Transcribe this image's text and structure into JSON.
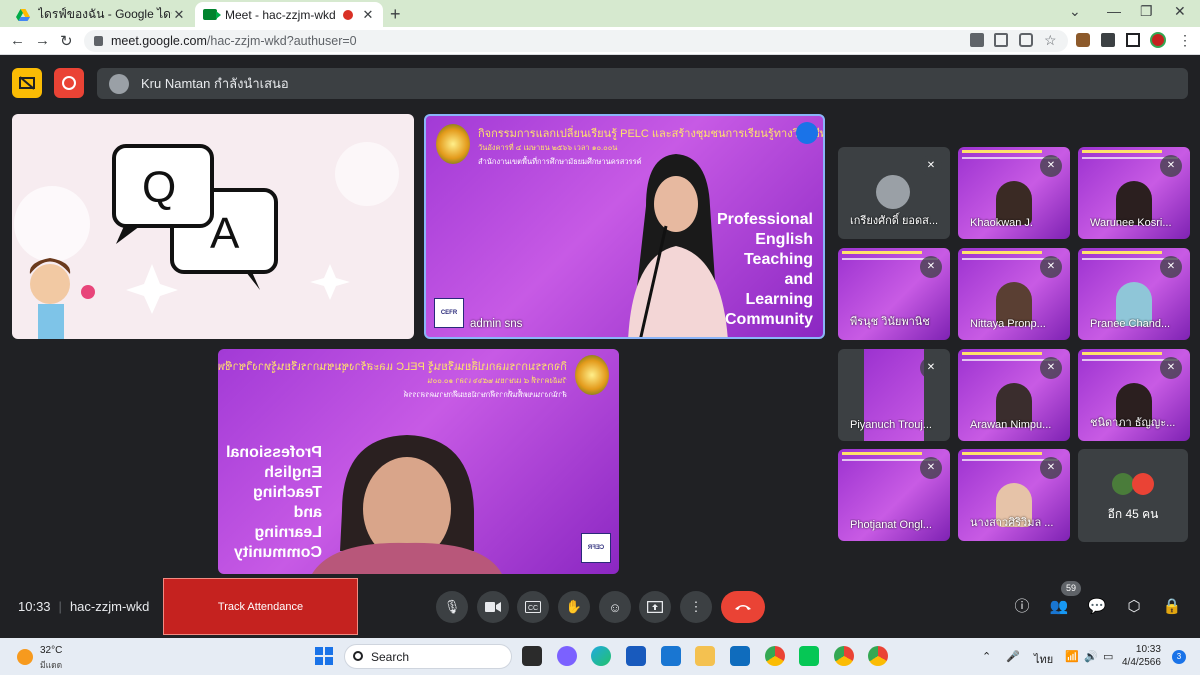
{
  "browser": {
    "tabs": [
      {
        "title": "ไดรฟ์ของฉัน - Google ไดรฟ์",
        "icon": "google-drive-icon"
      },
      {
        "title": "Meet - hac-zzjm-wkd",
        "icon": "google-meet-icon",
        "recording": true
      }
    ],
    "url_host": "meet.google.com",
    "url_path": "/hac-zzjm-wkd?authuser=0"
  },
  "meet": {
    "presenter_banner": "Kru Namtan กำลังนำเสนอ",
    "main_tiles": [
      {
        "name": "admin sns"
      }
    ],
    "slide": {
      "program": "PELC",
      "title_line": "กิจกรรมการแลกเปลี่ยนเรียนรู้ PELC และสร้างชุมชนการเรียนรู้ทางวิชาชีพภาษาอังกฤษ",
      "date_line": "วันอังคารที่ ๔ เมษายน ๒๕๖๖ เวลา ๑๐.๐๐น",
      "office_line": "สำนักงานเขตพื้นที่การศึกษามัธยมศึกษานครสวรรค์",
      "pet_lines": [
        "Professional",
        "English",
        "Teaching",
        "and",
        "Learning",
        "Community"
      ],
      "cefr": "CEFR"
    },
    "participants": [
      {
        "name": "เกรียงศักดิ์ ยอดส...",
        "video": false
      },
      {
        "name": "Khaokwan J.",
        "video": true
      },
      {
        "name": "Warunee Kosri...",
        "video": true
      },
      {
        "name": "พีรนุช วินัยพานิช",
        "video": true
      },
      {
        "name": "Nittaya Pronp...",
        "video": true
      },
      {
        "name": "Pranee Chand...",
        "video": true
      },
      {
        "name": "Piyanuch Trouj...",
        "video": true
      },
      {
        "name": "Arawan Nimpu...",
        "video": true
      },
      {
        "name": "ชนิดาภา ธัญญะ...",
        "video": true
      },
      {
        "name": "Photjanat Ongl...",
        "video": true
      },
      {
        "name": "นางสาวศิริวิมล ...",
        "video": true
      }
    ],
    "more_label": "อีก 45 คน",
    "time": "10:33",
    "meeting_code": "hac-zzjm-wkd",
    "track_attendance": "Track Attendance",
    "participant_count": "59"
  },
  "taskbar": {
    "temperature": "32°C",
    "weather_status": "มีแดด",
    "search_label": "Search",
    "language": "ไทย",
    "clock_time": "10:33",
    "clock_date": "4/4/2566",
    "notification_count": "3"
  }
}
